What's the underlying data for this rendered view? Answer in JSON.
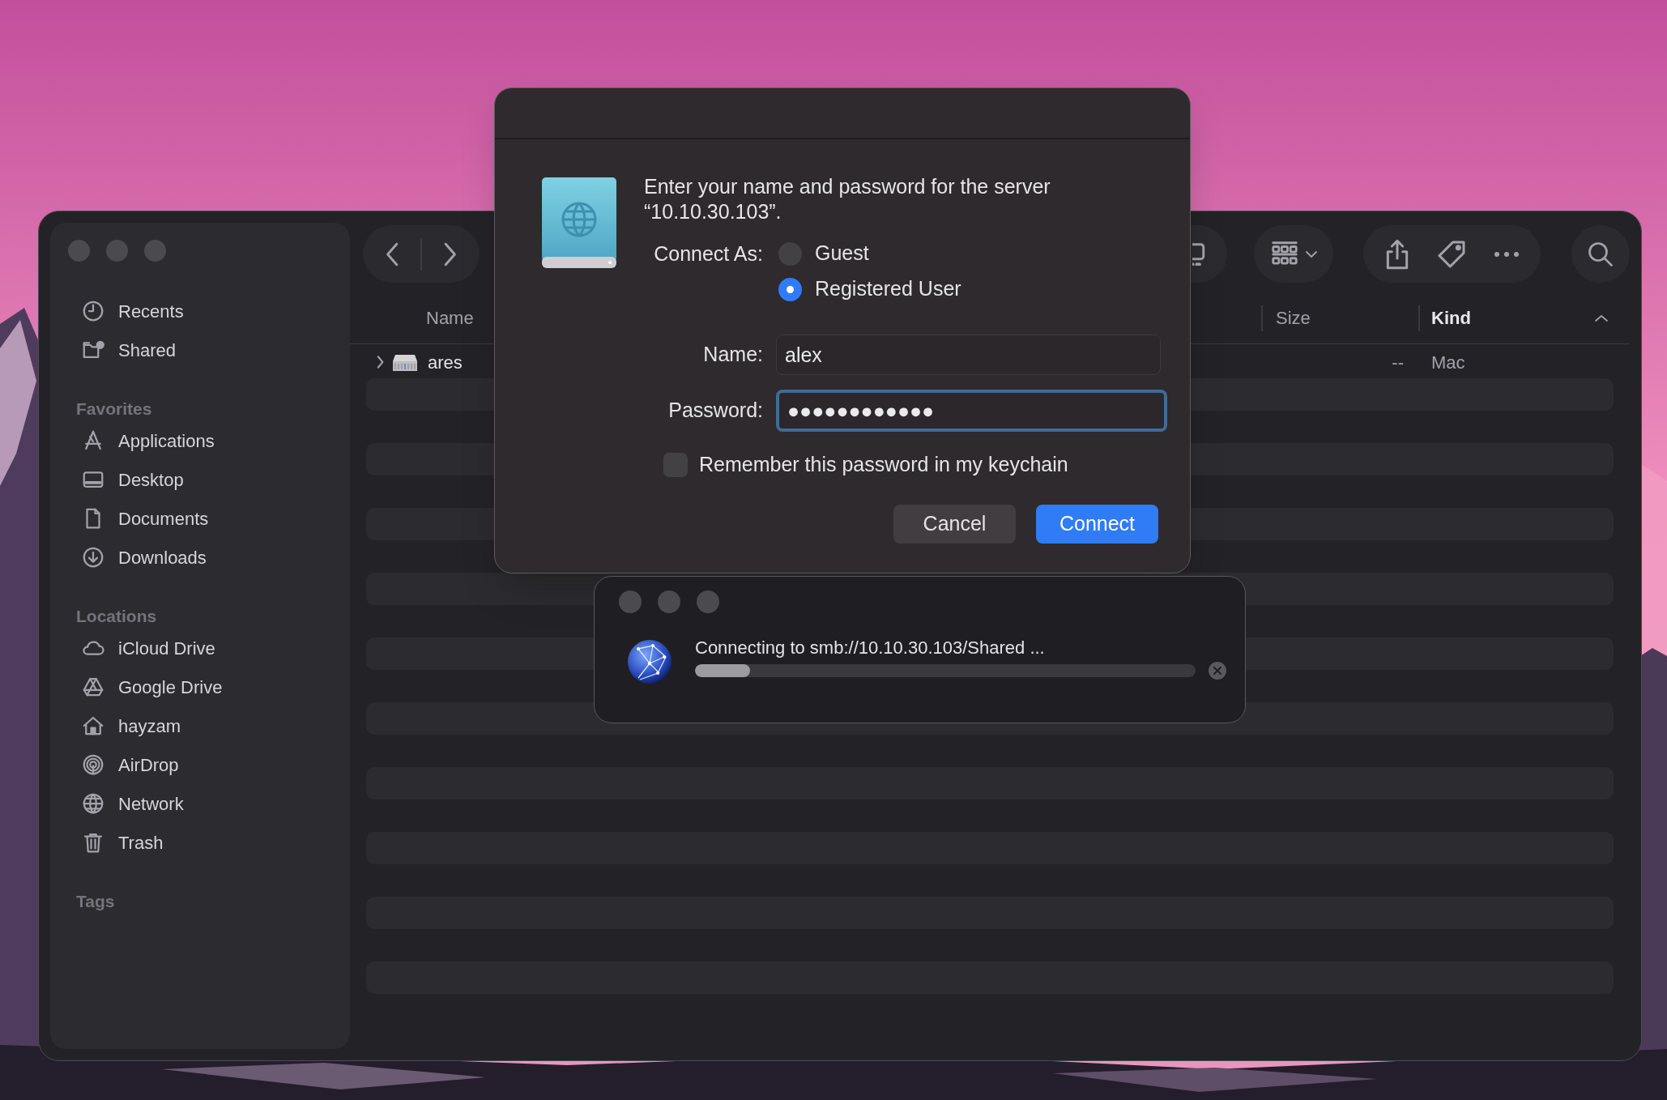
{
  "finder": {
    "sidebar": {
      "sections": [
        {
          "items": [
            {
              "label": "Recents"
            },
            {
              "label": "Shared"
            }
          ]
        },
        {
          "header": "Favorites",
          "items": [
            {
              "label": "Applications"
            },
            {
              "label": "Desktop"
            },
            {
              "label": "Documents"
            },
            {
              "label": "Downloads"
            }
          ]
        },
        {
          "header": "Locations",
          "items": [
            {
              "label": "iCloud Drive"
            },
            {
              "label": "Google Drive"
            },
            {
              "label": "hayzam"
            },
            {
              "label": "AirDrop"
            },
            {
              "label": "Network"
            },
            {
              "label": "Trash"
            }
          ]
        },
        {
          "header": "Tags"
        }
      ]
    },
    "table": {
      "columns": [
        {
          "label": "Name",
          "sorted": false
        },
        {
          "label": "Size",
          "sorted": false
        },
        {
          "label": "Kind",
          "sorted": true
        }
      ],
      "rows": [
        {
          "name": "ares",
          "size": "--",
          "kind": "Mac",
          "expanded": false
        }
      ]
    }
  },
  "login_dialog": {
    "message": "Enter your name and password for the server “10.10.30.103”.",
    "connect_as_label": "Connect As:",
    "options": [
      {
        "label": "Guest",
        "selected": false
      },
      {
        "label": "Registered User",
        "selected": true
      }
    ],
    "fields": [
      {
        "label": "Name:",
        "value": "alex",
        "focused": false
      },
      {
        "label": "Password:",
        "value": "●●●●●●●●●●●●",
        "focused": true
      }
    ],
    "remember": {
      "label": "Remember this password in my keychain",
      "checked": false
    },
    "buttons": [
      {
        "label": "Cancel",
        "kind": "secondary"
      },
      {
        "label": "Connect",
        "kind": "primary"
      }
    ]
  },
  "progress": {
    "message": "Connecting to smb://10.10.30.103/Shared ...",
    "level": 0.11
  }
}
